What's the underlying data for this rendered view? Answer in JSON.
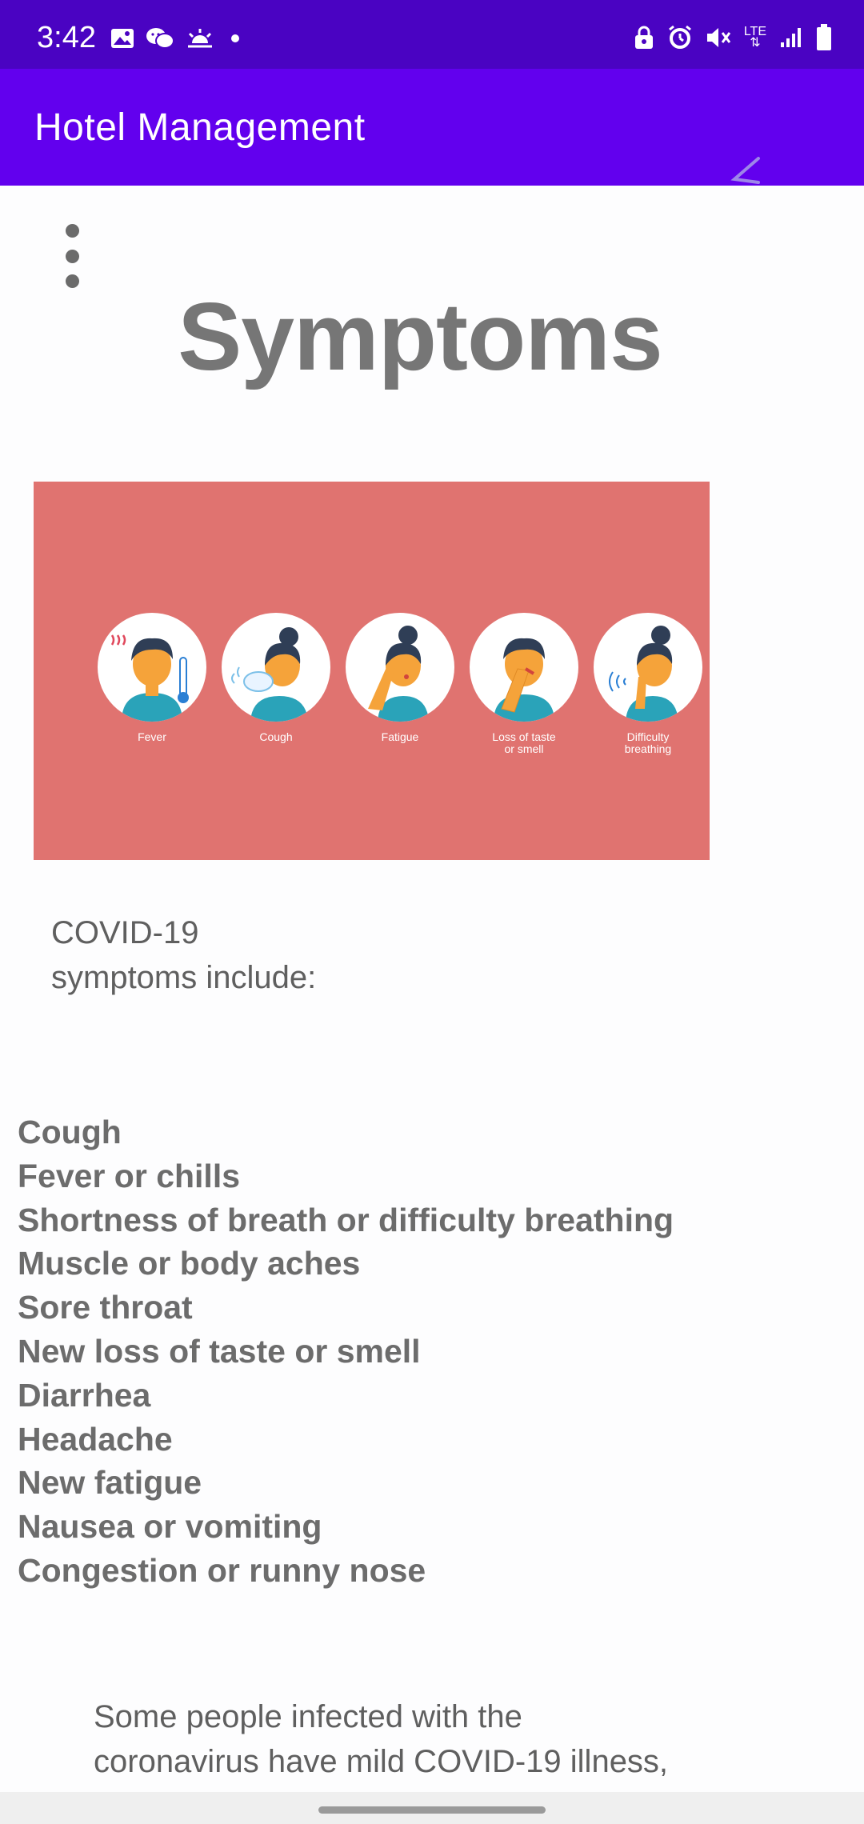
{
  "status_bar": {
    "time": "3:42",
    "left_icons": [
      "gallery-icon",
      "wechat-icon",
      "weather-icon",
      "notification-dot-icon"
    ],
    "right_icons": [
      "lock-icon",
      "alarm-icon",
      "mute-icon",
      "lte-icon",
      "signal-icon",
      "battery-icon"
    ],
    "network_label": "LTE"
  },
  "app_bar": {
    "title": "Hotel Management",
    "color": "#6200ee"
  },
  "page": {
    "heading": "Symptoms",
    "banner": {
      "background": "#e07370",
      "items": [
        {
          "label": "Fever"
        },
        {
          "label": "Cough"
        },
        {
          "label": "Fatigue"
        },
        {
          "label_line1": "Loss of taste",
          "label_line2": "or smell"
        },
        {
          "label_line1": "Difficulty",
          "label_line2": "breathing"
        }
      ]
    },
    "intro_line1": "COVID-19",
    "intro_line2": "symptoms include:",
    "symptoms": [
      "Cough",
      "Fever or chills",
      "Shortness of breath or difficulty breathing",
      "Muscle or body aches",
      "Sore throat",
      "New loss of taste or smell",
      "Diarrhea",
      "Headache",
      "New fatigue",
      "Nausea or vomiting",
      "Congestion or runny nose"
    ],
    "paragraph_line1": "Some people infected with the",
    "paragraph_line2": "coronavirus have mild COVID-19 illness,"
  }
}
